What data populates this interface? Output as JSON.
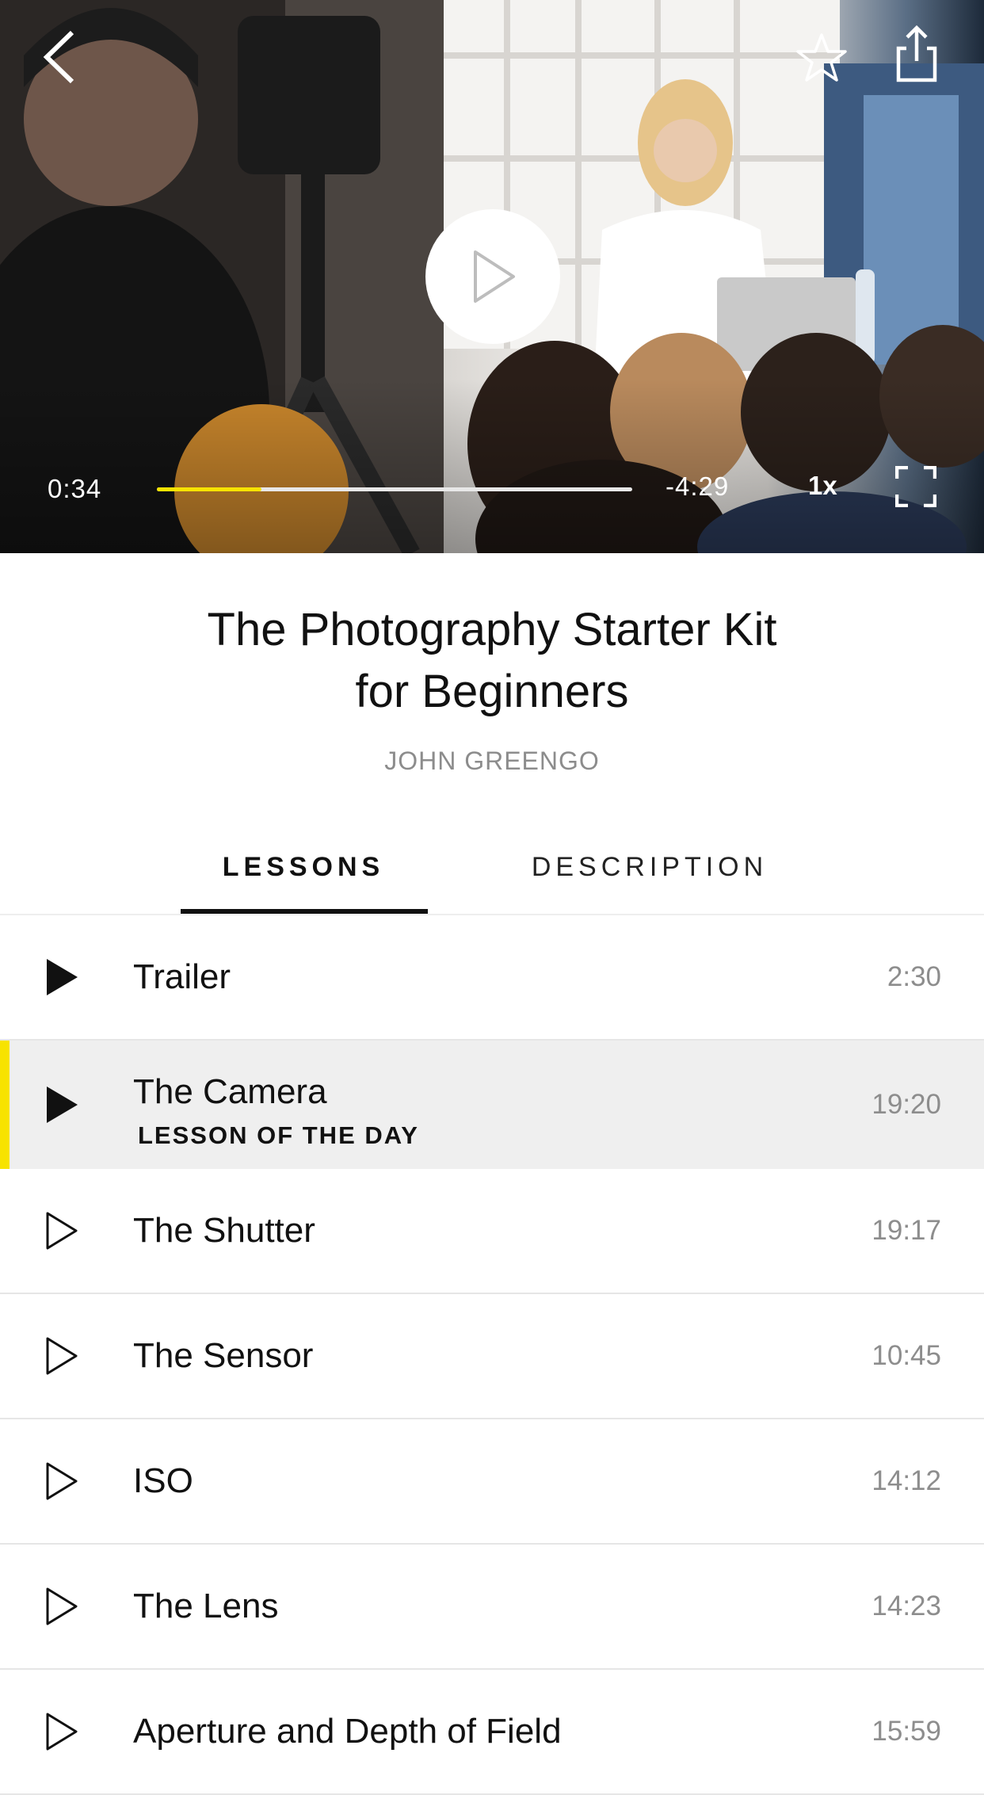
{
  "video": {
    "elapsed": "0:34",
    "remaining": "-4:29",
    "speed": "1x",
    "progress_fraction": 0.22,
    "accent_color": "#f7e300",
    "icons": [
      "back-arrow-icon",
      "star-icon",
      "share-icon",
      "play-icon",
      "fullscreen-icon"
    ]
  },
  "course": {
    "title_line1": "The Photography Starter Kit",
    "title_line2": "for Beginners",
    "author": "JOHN GREENGO"
  },
  "tabs": [
    {
      "label": "LESSONS",
      "selected": true
    },
    {
      "label": "DESCRIPTION",
      "selected": false
    }
  ],
  "lessons": [
    {
      "title": "Trailer",
      "duration": "2:30",
      "icon": "play-filled-icon"
    },
    {
      "title": "The Camera",
      "subtitle": "LESSON OF THE DAY",
      "duration": "19:20",
      "icon": "play-filled-icon",
      "active": true
    },
    {
      "title": "The Shutter",
      "duration": "19:17",
      "icon": "play-outline-icon"
    },
    {
      "title": "The Sensor",
      "duration": "10:45",
      "icon": "play-outline-icon"
    },
    {
      "title": "ISO",
      "duration": "14:12",
      "icon": "play-outline-icon"
    },
    {
      "title": "The Lens",
      "duration": "14:23",
      "icon": "play-outline-icon"
    },
    {
      "title": "Aperture and Depth of Field",
      "duration": "15:59",
      "icon": "play-outline-icon"
    }
  ]
}
